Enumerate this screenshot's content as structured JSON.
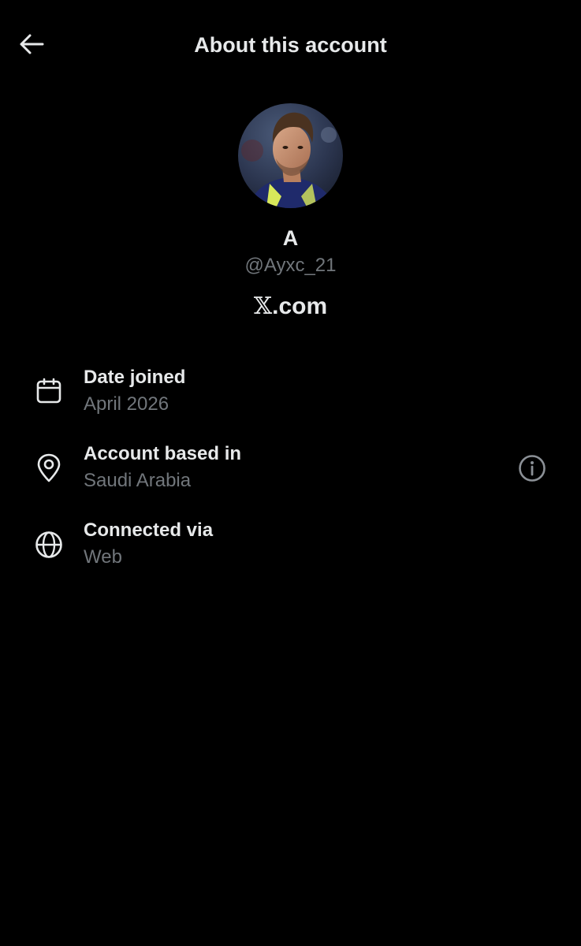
{
  "header": {
    "title": "About this account",
    "back_icon": "arrow-left-icon"
  },
  "profile": {
    "avatar_icon": "profile-photo",
    "display_name": "A",
    "handle": "@Ayxc_21",
    "platform_logo": "𝕏",
    "platform_suffix": ".com"
  },
  "details": {
    "date_joined": {
      "icon": "calendar-icon",
      "label": "Date joined",
      "value": "April 2026"
    },
    "based_in": {
      "icon": "location-pin-icon",
      "label": "Account based in",
      "value": "Saudi Arabia",
      "info_icon": "info-icon"
    },
    "connected_via": {
      "icon": "globe-icon",
      "label": "Connected via",
      "value": "Web"
    }
  },
  "colors": {
    "background": "#000000",
    "primary_text": "#e7e9ea",
    "secondary_text": "#71767b"
  }
}
